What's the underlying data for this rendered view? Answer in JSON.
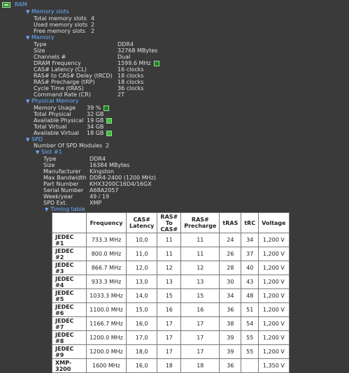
{
  "ram_title": "RAM",
  "memory_slots": {
    "header": "Memory slots",
    "rows": [
      {
        "k": "Total memory slots",
        "v": "4"
      },
      {
        "k": "Used memory slots",
        "v": "2"
      },
      {
        "k": "Free memory slots",
        "v": "2"
      }
    ]
  },
  "memory": {
    "header": "Memory",
    "rows": [
      {
        "k": "Type",
        "v": "DDR4"
      },
      {
        "k": "Size",
        "v": "32768 MBytes"
      },
      {
        "k": "Channels #",
        "v": "Dual"
      },
      {
        "k": "DRAM Frequency",
        "v": "1599.6 MHz"
      },
      {
        "k": "CAS# Latency (CL)",
        "v": "16 clocks"
      },
      {
        "k": "RAS# to CAS# Delay (tRCD)",
        "v": "18 clocks"
      },
      {
        "k": "RAS# Precharge (tRP)",
        "v": "18 clocks"
      },
      {
        "k": "Cycle Time (tRAS)",
        "v": "36 clocks"
      },
      {
        "k": "Command Rate (CR)",
        "v": "2T"
      }
    ]
  },
  "physical_memory": {
    "header": "Physical Memory",
    "rows": [
      {
        "k": "Memory Usage",
        "v": "39 %"
      },
      {
        "k": "Total Physical",
        "v": "32 GB"
      },
      {
        "k": "Available Physical",
        "v": "19 GB"
      },
      {
        "k": "Total Virtual",
        "v": "34 GB"
      },
      {
        "k": "Available Virtual",
        "v": "18 GB"
      }
    ]
  },
  "spd": {
    "header": "SPD",
    "modules_label": "Number Of SPD Modules",
    "modules_value": "2",
    "slot_header": "Slot #1",
    "rows": [
      {
        "k": "Type",
        "v": "DDR4"
      },
      {
        "k": "Size",
        "v": "16384 MBytes"
      },
      {
        "k": "Manufacturer",
        "v": "Kingston"
      },
      {
        "k": "Max Bandwidth",
        "v": "DDR4-2400 (1200 MHz)"
      },
      {
        "k": "Part Number",
        "v": "KHX3200C16D4/16GX"
      },
      {
        "k": "Serial Number",
        "v": "A68A2057"
      },
      {
        "k": "Week/year",
        "v": "49 / 19"
      },
      {
        "k": "SPD Ext.",
        "v": "XMP"
      }
    ],
    "timing_header": "Timing table"
  },
  "timing": {
    "columns": [
      "",
      "Frequency",
      "CAS#\nLatency",
      "RAS#\nTo\nCAS#",
      "RAS#\nPrecharge",
      "tRAS",
      "tRC",
      "Voltage"
    ],
    "rows": [
      [
        "JEDEC #1",
        "733.3 MHz",
        "10,0",
        "11",
        "11",
        "24",
        "34",
        "1,200 V"
      ],
      [
        "JEDEC #2",
        "800.0 MHz",
        "11,0",
        "11",
        "11",
        "26",
        "37",
        "1,200 V"
      ],
      [
        "JEDEC #3",
        "866.7 MHz",
        "12,0",
        "12",
        "12",
        "28",
        "40",
        "1,200 V"
      ],
      [
        "JEDEC #4",
        "933.3 MHz",
        "13,0",
        "13",
        "13",
        "30",
        "43",
        "1,200 V"
      ],
      [
        "JEDEC #5",
        "1033.3 MHz",
        "14,0",
        "15",
        "15",
        "34",
        "48",
        "1,200 V"
      ],
      [
        "JEDEC #6",
        "1100.0 MHz",
        "15,0",
        "16",
        "16",
        "36",
        "51",
        "1,200 V"
      ],
      [
        "JEDEC #7",
        "1166.7 MHz",
        "16,0",
        "17",
        "17",
        "38",
        "54",
        "1,200 V"
      ],
      [
        "JEDEC #8",
        "1200.0 MHz",
        "17,0",
        "17",
        "17",
        "39",
        "55",
        "1,200 V"
      ],
      [
        "JEDEC #9",
        "1200.0 MHz",
        "18,0",
        "17",
        "17",
        "39",
        "55",
        "1,200 V"
      ],
      [
        "XMP-3200",
        "1600 MHz",
        "16,0",
        "18",
        "18",
        "36",
        "",
        "1,350 V"
      ]
    ]
  }
}
